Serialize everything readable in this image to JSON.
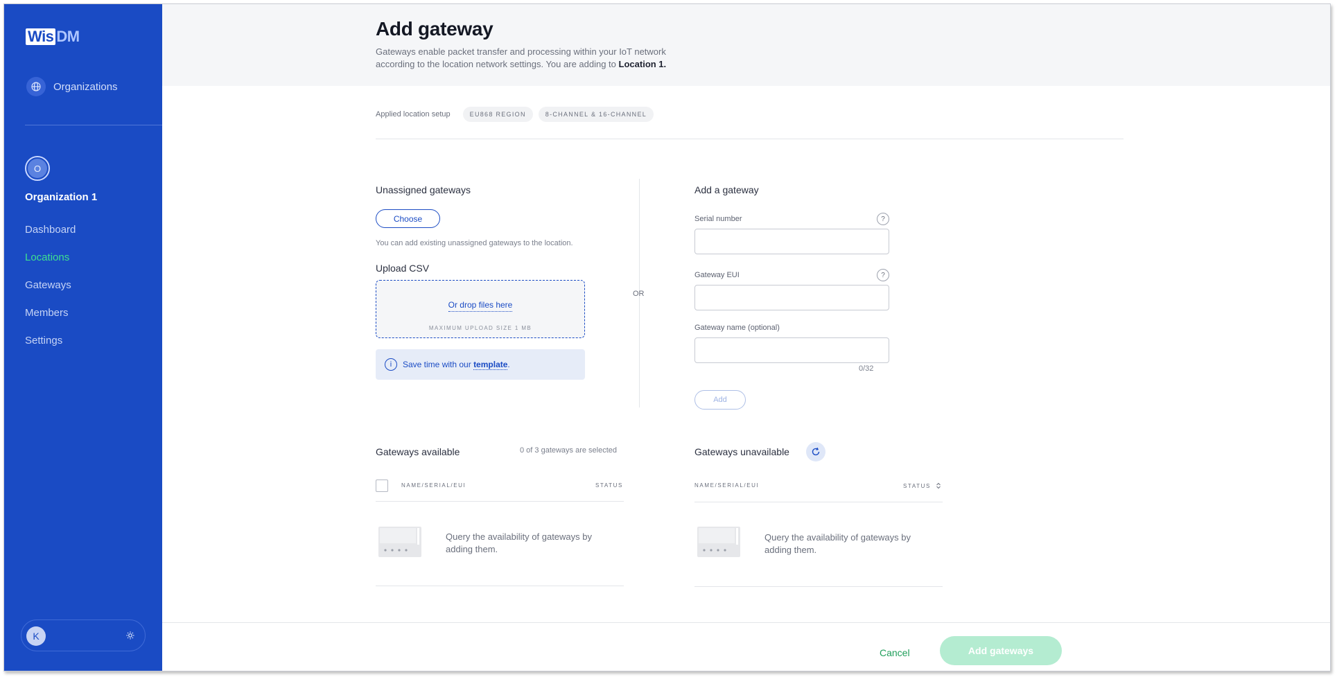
{
  "brand": {
    "logo_part1": "Wis",
    "logo_part2": "DM"
  },
  "sidebar": {
    "organizations_label": "Organizations",
    "org_avatar_letter": "O",
    "org_name": "Organization 1",
    "nav": [
      {
        "label": "Dashboard",
        "active": false
      },
      {
        "label": "Locations",
        "active": true
      },
      {
        "label": "Gateways",
        "active": false
      },
      {
        "label": "Members",
        "active": false
      },
      {
        "label": "Settings",
        "active": false
      }
    ],
    "user_avatar_letter": "K"
  },
  "header": {
    "title": "Add gateway",
    "subtitle": "Gateways enable packet transfer and processing within your IoT network according to the location network settings. You are adding to",
    "location": "Location 1."
  },
  "setup": {
    "label": "Applied location setup",
    "chips": [
      "EU868 REGION",
      "8-CHANNEL & 16-CHANNEL"
    ]
  },
  "unassigned": {
    "title": "Unassigned gateways",
    "choose_label": "Choose",
    "hint": "You can add existing unassigned gateways to the location."
  },
  "upload": {
    "title": "Upload CSV",
    "drop_label": "Or drop files here",
    "max_size": "MAXIMUM UPLOAD SIZE 1 MB",
    "tip_prefix": "Save time with our",
    "tip_link": "template",
    "tip_suffix": "."
  },
  "or_label": "OR",
  "add_form": {
    "title": "Add a gateway",
    "serial_label": "Serial number",
    "eui_label": "Gateway EUI",
    "name_label": "Gateway name (optional)",
    "serial_value": "",
    "eui_value": "",
    "name_value": "",
    "name_counter": "0/32",
    "add_label": "Add",
    "help_glyph": "?"
  },
  "available": {
    "title": "Gateways available",
    "selected_count": "0 of 3 gateways are selected",
    "col_name": "NAME/SERIAL/EUI",
    "col_status": "STATUS",
    "empty_text": "Query the availability of gateways by adding them."
  },
  "unavailable": {
    "title": "Gateways unavailable",
    "col_name": "NAME/SERIAL/EUI",
    "col_status": "STATUS",
    "empty_text": "Query the availability of gateways by adding them."
  },
  "footer": {
    "cancel_label": "Cancel",
    "submit_label": "Add gateways"
  },
  "colors": {
    "sidebar": "#1a4bc4",
    "active_nav": "#3ee08f",
    "primary_disabled": "#b4ecd1",
    "cancel": "#1f9e5a"
  }
}
